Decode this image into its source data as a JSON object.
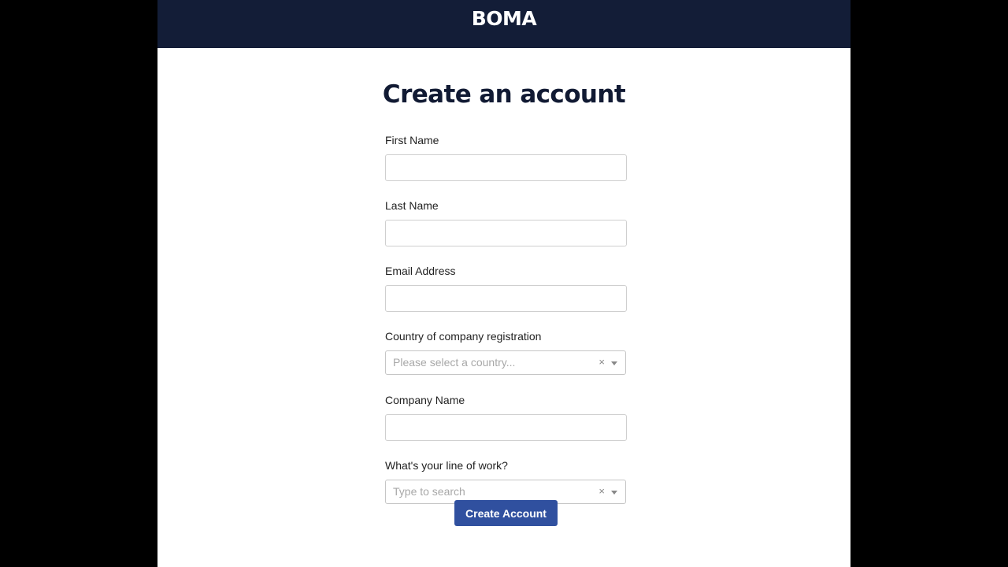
{
  "header": {
    "logo_text": "BOMA"
  },
  "page_title": "Create an account",
  "form": {
    "first_name": {
      "label": "First Name",
      "value": ""
    },
    "last_name": {
      "label": "Last Name",
      "value": ""
    },
    "email": {
      "label": "Email Address",
      "value": ""
    },
    "country": {
      "label": "Country of company registration",
      "placeholder": "Please select a country...",
      "clear_symbol": "×"
    },
    "company_name": {
      "label": "Company Name",
      "value": ""
    },
    "line_of_work": {
      "label": "What's your line of work?",
      "placeholder": "Type to search",
      "clear_symbol": "×"
    },
    "submit_label": "Create Account"
  },
  "colors": {
    "header_bg": "#131d37",
    "title_text": "#111a33",
    "button_bg": "#30509f",
    "outer_bg": "#000000"
  }
}
